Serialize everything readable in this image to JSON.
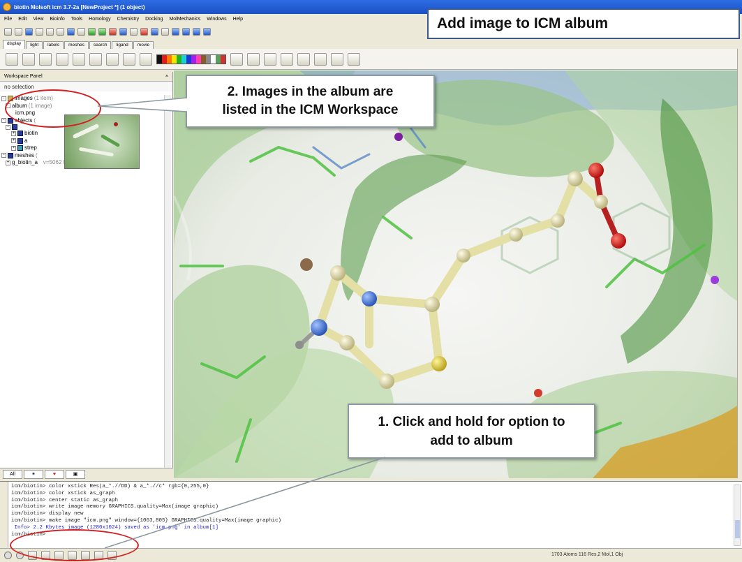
{
  "window": {
    "title": "biotin Molsoft icm 3.7-2a [NewProject *] (1 object)"
  },
  "menu": [
    "File",
    "Edit",
    "View",
    "Bioinfo",
    "Tools",
    "Homology",
    "Chemistry",
    "Docking",
    "MolMechanics",
    "Windows",
    "Help"
  ],
  "tabs": [
    "display",
    "light",
    "labels",
    "meshes",
    "search",
    "ligand",
    "movie"
  ],
  "banner": "Add image to ICM album",
  "workspace": {
    "title": "Workspace Panel",
    "close_glyph": "×",
    "selection": "no selection",
    "tree": {
      "images": "images",
      "images_count": "(1 item)",
      "album": "album",
      "album_count": "(1 image)",
      "file": "icm.png",
      "objects": "objects",
      "objects_count": "(",
      "biotin": "biotin",
      "a": "a",
      "strep": "strep",
      "meshes": "meshes",
      "meshes_count": "(",
      "mesh": "g_biotin_a",
      "mesh_info": "v=5062 f=10818 t=10109"
    },
    "bottom_tabs": [
      "All",
      "",
      ""
    ]
  },
  "callouts": {
    "c2_line1": "2. Images in the album are",
    "c2_line2": "listed in the ICM Workspace",
    "c1_line1": "1. Click and hold for option to",
    "c1_line2": "add to album"
  },
  "terminal": {
    "lines": [
      "icm/biotin> color xstick Res(a_*.//DD) & a_*.//c* rgb={0,255,0}",
      "icm/biotin> color xstick as_graph",
      "icm/biotin> center static as_graph",
      "icm/biotin> write image memory GRAPHICS.quality=Max(image graphic)",
      "icm/biotin> display new",
      "icm/biotin> make image \"icm.png\" window={1063,805} GRAPHICS.quality=Max(image graphic)",
      " Info> 2.2 Kbytes image (1280x1024) saved as 'icm.png' in album[1]",
      "icm/biotin> "
    ]
  },
  "status": "1703 Atoms 116 Res,2 Mol,1 Obj",
  "colors": {
    "accent": "#d32020",
    "titlebar": "#1c4fc5",
    "banner_border": "#3c5a8a"
  }
}
